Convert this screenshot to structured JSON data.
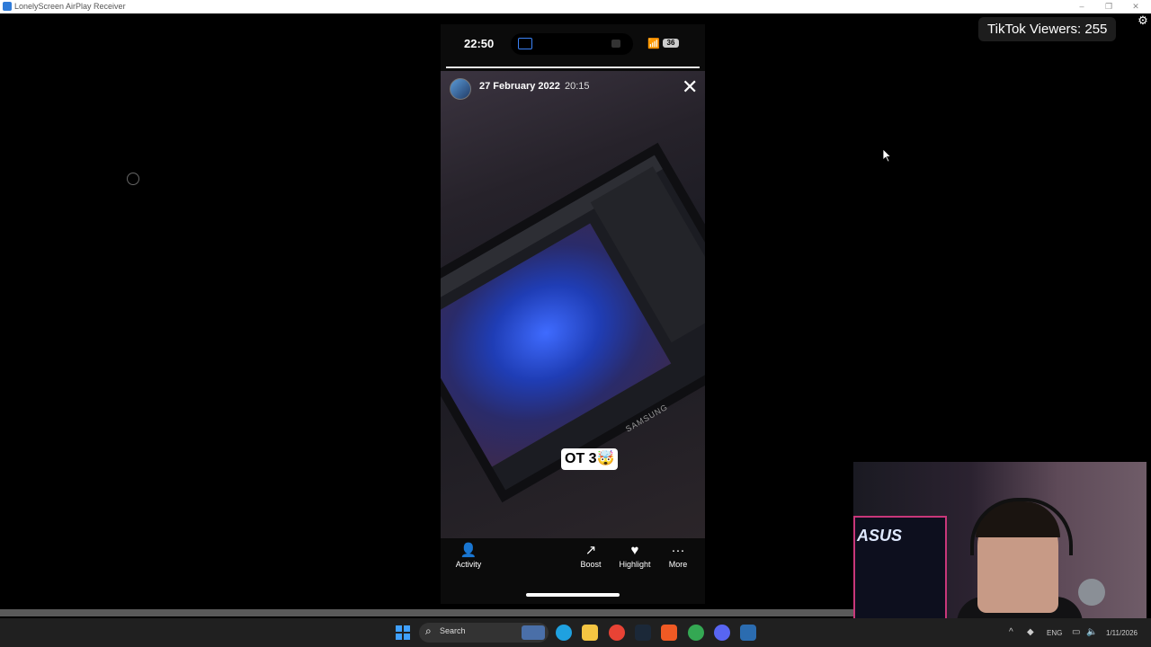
{
  "window": {
    "title": "LonelyScreen AirPlay Receiver",
    "controls": [
      "–",
      "❐",
      "✕"
    ]
  },
  "overlay": {
    "viewers_label": "TikTok Viewers: 255",
    "settings_icon": "gear-icon"
  },
  "phone": {
    "status_time": "22:50",
    "battery": "36",
    "story": {
      "date": "27 February 2022",
      "time": "20:15",
      "sticker_text": "ОТ 3🤯",
      "monitor_brand": "SAMSUNG",
      "progress": 1.0
    },
    "actions": [
      {
        "label": "Activity",
        "icon": "people-icon"
      },
      {
        "label": "Boost",
        "icon": "trend-up-icon"
      },
      {
        "label": "Highlight",
        "icon": "heart-icon"
      },
      {
        "label": "More",
        "icon": "ellipsis-icon"
      }
    ]
  },
  "webcam": {
    "logo_text": "ASUS"
  },
  "taskbar": {
    "search_label": "Search",
    "apps": [
      {
        "name": "edge-icon",
        "color": "#1fa1e0"
      },
      {
        "name": "file-explorer-icon",
        "color": "#f4c542"
      },
      {
        "name": "chrome-icon",
        "color": "#e84335"
      },
      {
        "name": "steam-icon",
        "color": "#1b2838"
      },
      {
        "name": "brave-icon",
        "color": "#f05a24"
      },
      {
        "name": "chrome-dev-icon",
        "color": "#34a853"
      },
      {
        "name": "discord-icon",
        "color": "#5865f2"
      },
      {
        "name": "remote-desktop-icon",
        "color": "#2b6cb0"
      }
    ],
    "tray": {
      "language": "ENG",
      "date": "1/11/2026"
    }
  }
}
